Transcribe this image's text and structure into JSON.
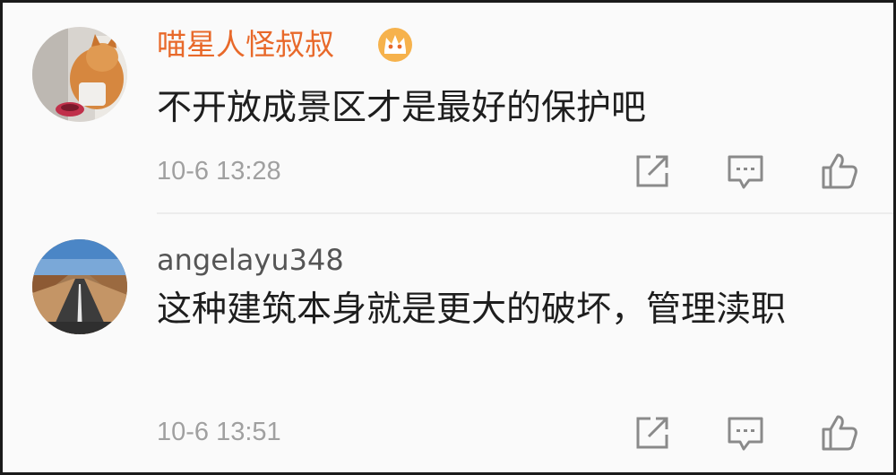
{
  "comments": [
    {
      "username": "喵星人怪叔叔",
      "text": "不开放成景区才是最好的保护吧",
      "time": "10-6 13:28",
      "avatar_icon": "cat-avatar",
      "badge_icon": "crown-icon",
      "username_color": "#e8692a"
    },
    {
      "username": "angelayu348",
      "text": "这种建筑本身就是更大的破坏，管理渎职",
      "time": "10-6 13:51",
      "avatar_icon": "desert-road-avatar",
      "username_color": "#555555"
    }
  ],
  "actions": [
    "share-icon",
    "reply-icon",
    "like-icon"
  ]
}
